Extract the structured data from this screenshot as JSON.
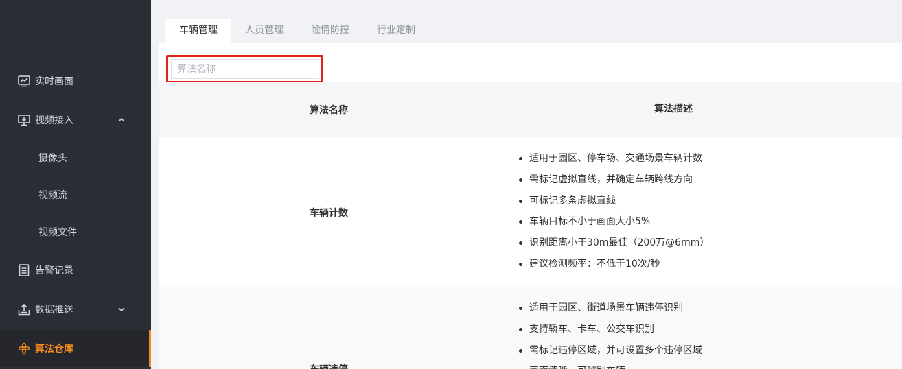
{
  "sidebar": {
    "items": [
      {
        "label": "实时画面",
        "icon": "monitor-chart-icon"
      },
      {
        "label": "视频接入",
        "icon": "video-input-icon",
        "expanded": true
      },
      {
        "label": "告警记录",
        "icon": "document-list-icon"
      },
      {
        "label": "数据推送",
        "icon": "upload-tray-icon",
        "expanded": false
      },
      {
        "label": "算法仓库",
        "icon": "algorithm-flower-icon",
        "active": true
      }
    ],
    "sub_items": [
      "摄像头",
      "视频流",
      "视频文件"
    ]
  },
  "tabs": [
    "车辆管理",
    "人员管理",
    "险情防控",
    "行业定制"
  ],
  "active_tab": "车辆管理",
  "search": {
    "placeholder": "算法名称",
    "value": ""
  },
  "table": {
    "columns": [
      "算法名称",
      "算法描述"
    ],
    "rows": [
      {
        "name": "车辆计数",
        "description": [
          "适用于园区、停车场、交通场景车辆计数",
          "需标记虚拟直线，并确定车辆跨线方向",
          "可标记多条虚拟直线",
          "车辆目标不小于画面大小5%",
          "识别距离小于30m最佳（200万@6mm）",
          "建议检测频率：不低于10次/秒"
        ]
      },
      {
        "name": "车辆违停",
        "description": [
          "适用于园区、街道场景车辆违停识别",
          "支持轿车、卡车、公交车识别",
          "需标记违停区域，并可设置多个违停区域",
          "画面清晰，可辨别车辆"
        ]
      }
    ]
  },
  "colors": {
    "sidebar_bg": "#2c2e36",
    "accent": "#f28b1e",
    "highlight_border": "#e5231b"
  }
}
